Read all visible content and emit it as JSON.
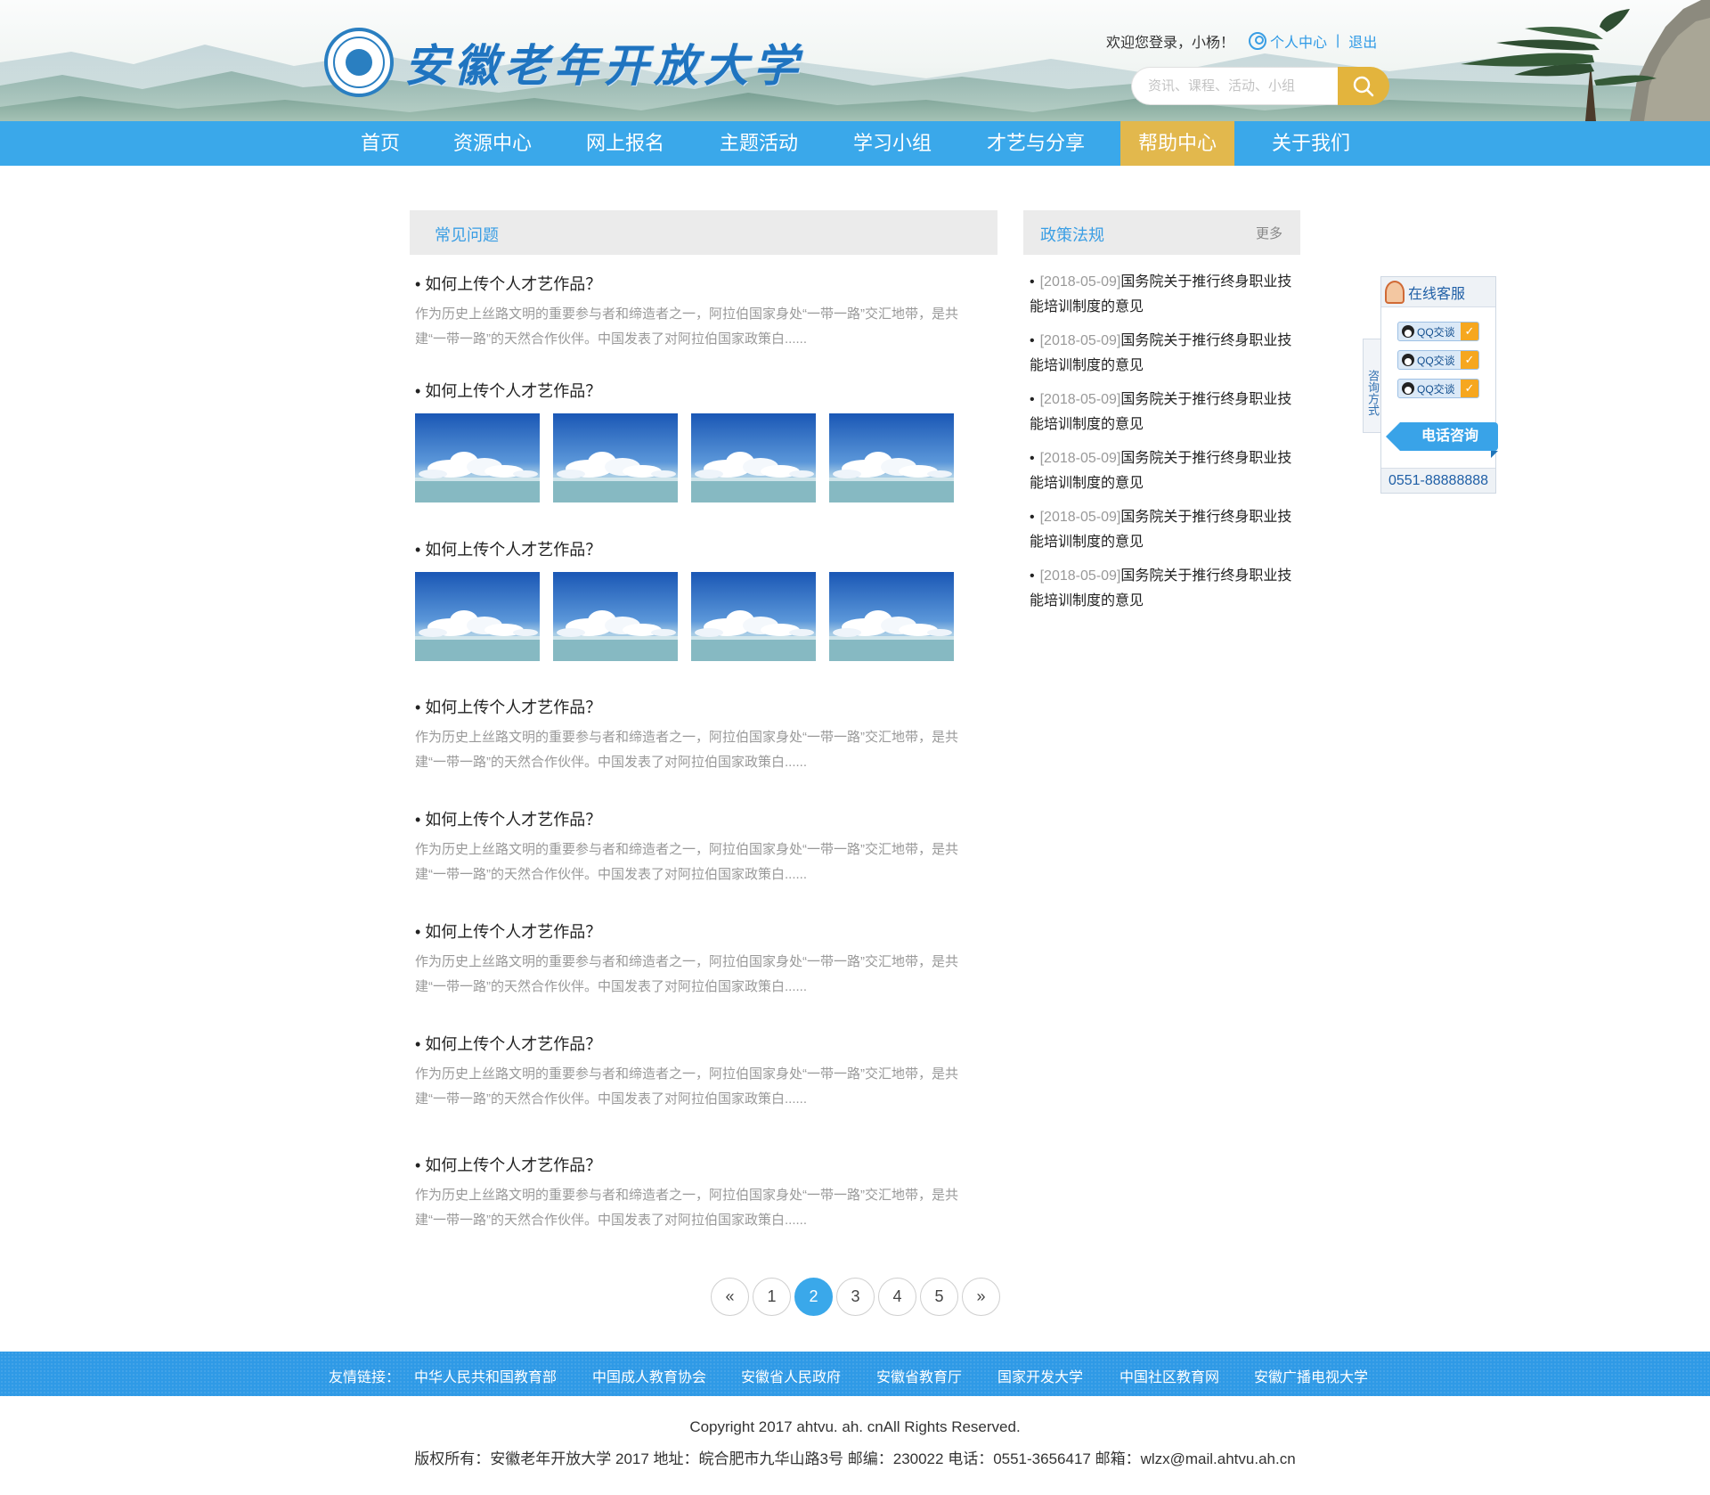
{
  "site": {
    "title": "安徽老年开放大学",
    "logo_icon": "university-emblem-icon"
  },
  "user_bar": {
    "welcome": "欢迎您登录，小杨！",
    "personal_center": "个人中心",
    "separator": "|",
    "logout": "退出"
  },
  "search": {
    "placeholder": "资讯、课程、活动、小组",
    "icon": "search-icon"
  },
  "nav": {
    "items": [
      "首页",
      "资源中心",
      "网上报名",
      "主题活动",
      "学习小组",
      "才艺与分享",
      "帮助中心",
      "关于我们"
    ],
    "active": "帮助中心"
  },
  "faq": {
    "title": "常见问题",
    "items": [
      {
        "question": "• 如何上传个人才艺作品？",
        "answer": "作为历史上丝路文明的重要参与者和缔造者之一，阿拉伯国家身处“一带一路”交汇地带，是共建“一带一路”的天然合作伙伴。中国发表了对阿拉伯国家政策白......"
      },
      {
        "question": "• 如何上传个人才艺作品？",
        "images": 4
      },
      {
        "question": "• 如何上传个人才艺作品？",
        "images": 4
      },
      {
        "question": "• 如何上传个人才艺作品？",
        "answer": "作为历史上丝路文明的重要参与者和缔造者之一，阿拉伯国家身处“一带一路”交汇地带，是共建“一带一路”的天然合作伙伴。中国发表了对阿拉伯国家政策白......"
      },
      {
        "question": "• 如何上传个人才艺作品？",
        "answer": "作为历史上丝路文明的重要参与者和缔造者之一，阿拉伯国家身处“一带一路”交汇地带，是共建“一带一路”的天然合作伙伴。中国发表了对阿拉伯国家政策白......"
      },
      {
        "question": "• 如何上传个人才艺作品？",
        "answer": "作为历史上丝路文明的重要参与者和缔造者之一，阿拉伯国家身处“一带一路”交汇地带，是共建“一带一路”的天然合作伙伴。中国发表了对阿拉伯国家政策白......"
      },
      {
        "question": "• 如何上传个人才艺作品？",
        "answer": "作为历史上丝路文明的重要参与者和缔造者之一，阿拉伯国家身处“一带一路”交汇地带，是共建“一带一路”的天然合作伙伴。中国发表了对阿拉伯国家政策白......"
      },
      {
        "question": "• 如何上传个人才艺作品？",
        "answer": "作为历史上丝路文明的重要参与者和缔造者之一，阿拉伯国家身处“一带一路”交汇地带，是共建“一带一路”的天然合作伙伴。中国发表了对阿拉伯国家政策白......"
      }
    ]
  },
  "policy": {
    "title": "政策法规",
    "more": "更多",
    "items": [
      {
        "date": "[2018-05-09]",
        "title": "国务院关于推行终身职业技能培训制度的意见"
      },
      {
        "date": "[2018-05-09]",
        "title": "国务院关于推行终身职业技能培训制度的意见"
      },
      {
        "date": "[2018-05-09]",
        "title": "国务院关于推行终身职业技能培训制度的意见"
      },
      {
        "date": "[2018-05-09]",
        "title": "国务院关于推行终身职业技能培训制度的意见"
      },
      {
        "date": "[2018-05-09]",
        "title": "国务院关于推行终身职业技能培训制度的意见"
      },
      {
        "date": "[2018-05-09]",
        "title": "国务院关于推行终身职业技能培训制度的意见"
      }
    ]
  },
  "online_service": {
    "title": "在线客服",
    "tab_label": "咨询方式",
    "qq_buttons": [
      "QQ交谈",
      "QQ交谈",
      "QQ交谈"
    ],
    "phone_button": "电话咨询",
    "phone": "0551-88888888"
  },
  "pagination": {
    "prev": "«",
    "pages": [
      "1",
      "2",
      "3",
      "4",
      "5"
    ],
    "current": "2",
    "next": "»"
  },
  "footer": {
    "links_label": "友情链接：",
    "links": [
      "中华人民共和国教育部",
      "中国成人教育协会",
      "安徽省人民政府",
      "安徽省教育厅",
      "国家开发大学",
      "中国社区教育网",
      "安徽广播电视大学"
    ],
    "copyright": "Copyright 2017 ahtvu. ah. cnAll Rights Reserved.",
    "info": "版权所有：安徽老年开放大学 2017 地址：皖合肥市九华山路3号 邮编：230022 电话：0551-3656417 邮箱：wlzx@mail.ahtvu.ah.cn"
  },
  "colors": {
    "nav_bg": "#3aa8ea",
    "nav_active": "#e2b84d",
    "accent_blue": "#3a9ee4",
    "search_button": "#e3b43d"
  }
}
